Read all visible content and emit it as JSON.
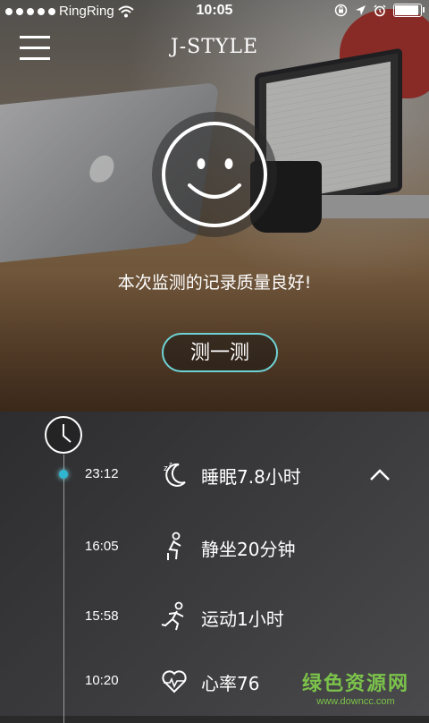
{
  "status_bar": {
    "carrier": "RingRing",
    "time": "10:05",
    "signal_bars": 5,
    "battery_level": 1.0
  },
  "header": {
    "logo": "J-STYLE",
    "menu_icon": "hamburger-menu-icon"
  },
  "hero": {
    "face_icon": "smiley-face-icon",
    "message": "本次监测的记录质量良好!",
    "measure_button": "测一测"
  },
  "timeline": {
    "clock_icon": "clock-icon",
    "accent_color": "#2fb5cf",
    "entries": [
      {
        "time": "23:12",
        "icon": "sleep-moon-icon",
        "label": "睡眠7.8小时",
        "expanded": true
      },
      {
        "time": "16:05",
        "icon": "sitting-person-icon",
        "label": "静坐20分钟"
      },
      {
        "time": "15:58",
        "icon": "running-person-icon",
        "label": "运动1小时"
      },
      {
        "time": "10:20",
        "icon": "heart-rate-icon",
        "label": "心率76"
      }
    ]
  },
  "watermark": {
    "name": "绿色资源网",
    "url": "www.downcc.com"
  }
}
